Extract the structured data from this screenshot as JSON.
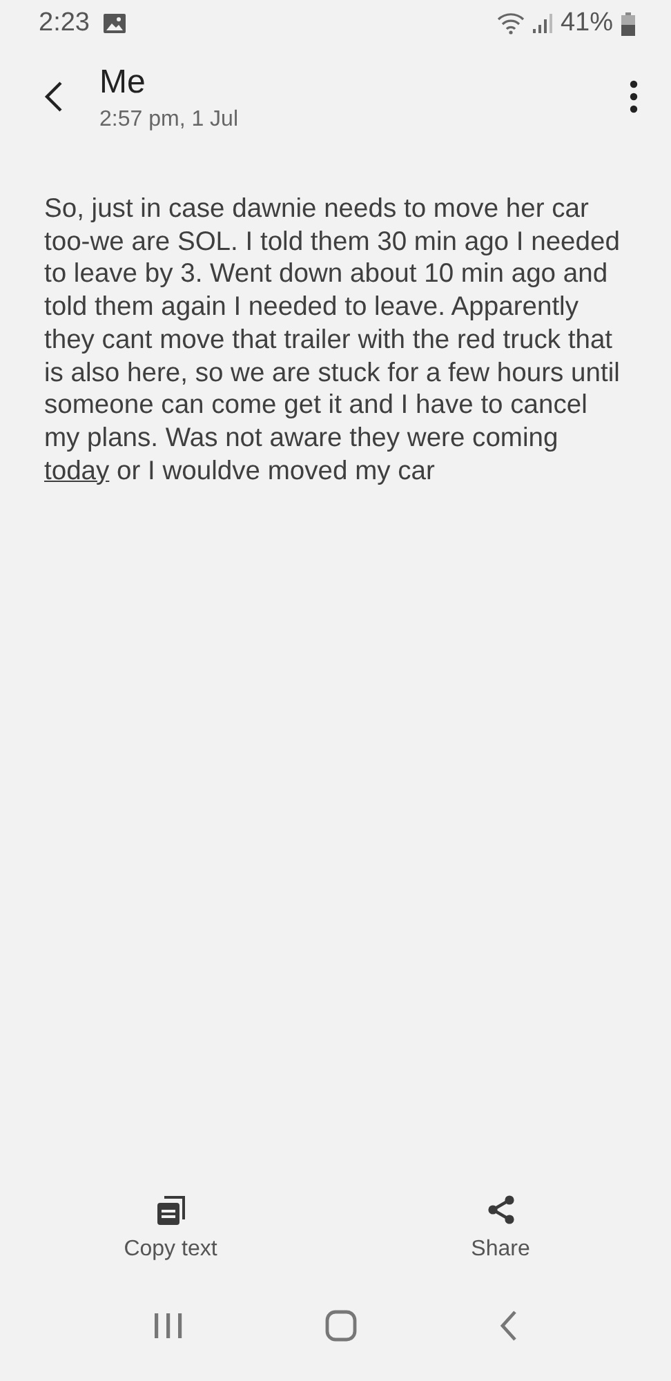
{
  "status_bar": {
    "time": "2:23",
    "battery": "41%"
  },
  "header": {
    "title": "Me",
    "subtitle": "2:57 pm, 1 Jul"
  },
  "message": {
    "before": "So, just in case dawnie needs to move her car too-we are SOL. I told them 30 min ago I needed to leave by 3. Went down about 10 min ago and told them again I needed to leave. Apparently they cant move that trailer with the red truck that is also here, so we are stuck for a few hours until someone can come get it and I have to cancel my plans. Was not aware they were coming ",
    "link": "today",
    "after": " or I wouldve moved my car"
  },
  "actions": [
    {
      "kind": "copy",
      "label": "Copy text"
    },
    {
      "kind": "share",
      "label": "Share"
    }
  ]
}
